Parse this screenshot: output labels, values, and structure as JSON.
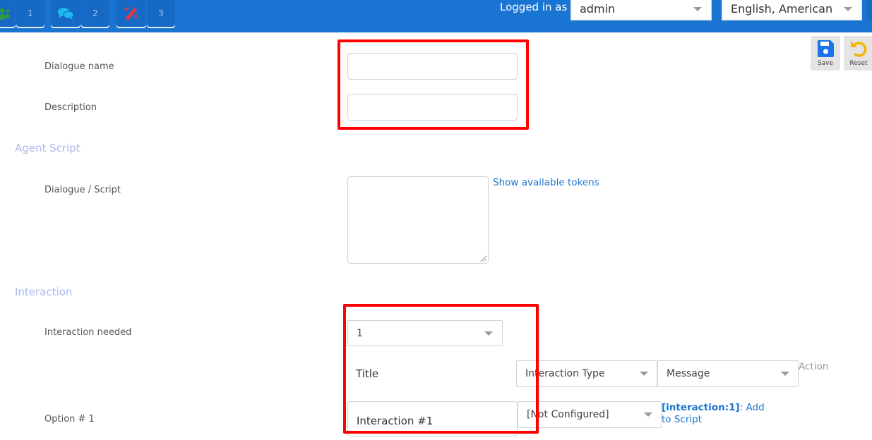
{
  "topbar": {
    "tabs": [
      {
        "icon": "users-icon",
        "icon_color": "#2e9a3e",
        "count": "1"
      },
      {
        "icon": "chat-bubbles-icon",
        "icon_color": "#1fb8f0",
        "count": "2"
      },
      {
        "icon": "magic-wand-icon",
        "icon_color": "#e03a4a",
        "count": "3"
      }
    ],
    "logged_in_label": "Logged in as :",
    "user_select": "admin",
    "language_select": "English, American"
  },
  "toolbar": {
    "save_label": "Save",
    "reset_label": "Reset",
    "save_color": "#1a73e8",
    "reset_color": "#f5b400"
  },
  "form": {
    "dialogue_name_label": "Dialogue name",
    "dialogue_name_value": "",
    "description_label": "Description",
    "description_value": "",
    "agent_script_section": "Agent Script",
    "dialogue_script_label": "Dialogue / Script",
    "dialogue_script_value": "",
    "show_tokens_link": "Show available tokens",
    "interaction_section": "Interaction",
    "interaction_needed_label": "Interaction needed",
    "interaction_needed_value": "1",
    "title_header": "Title",
    "interaction_type_select": "Interaction Type",
    "message_select": "Message",
    "action_header": "Action",
    "option_label": "Option # 1",
    "option_title_value": "Interaction #1",
    "option_action_select": "[Not Configured]",
    "token_link_bold": "[interaction:1]",
    "token_link_rest": ": Add to Script"
  },
  "colors": {
    "topbar": "#1a75d2",
    "section_heading": "#a9b9ee",
    "link": "#1a75d2",
    "highlight": "#ff0000"
  }
}
